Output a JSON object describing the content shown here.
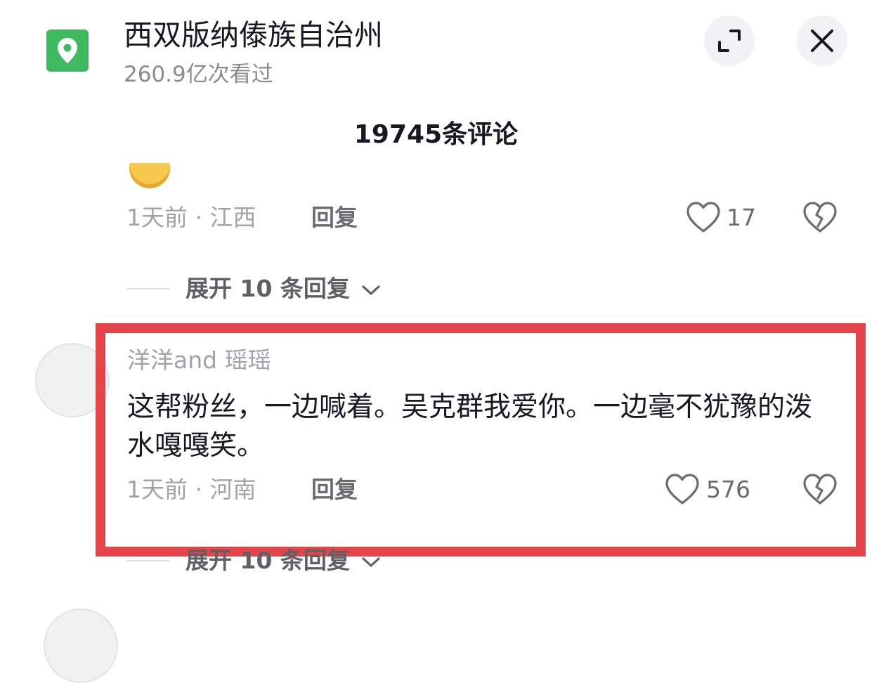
{
  "header": {
    "title": "西双版纳傣族自治州",
    "views": "260.9亿次看过"
  },
  "comment_count": "19745条评论",
  "comments": [
    {
      "time_location": "1天前 · 江西",
      "reply_label": "回复",
      "likes": "17",
      "expand_replies": "展开 10 条回复"
    },
    {
      "username": "洋洋and 瑶瑶",
      "text": "这帮粉丝，一边喊着。吴克群我爱你。一边毫不犹豫的泼水嘎嘎笑。",
      "time_location": "1天前 · 河南",
      "reply_label": "回复",
      "likes": "576",
      "expand_replies": "展开 10 条回复"
    }
  ],
  "colors": {
    "highlight_border": "#e5444a",
    "location_icon_bg": "#3fba63"
  }
}
